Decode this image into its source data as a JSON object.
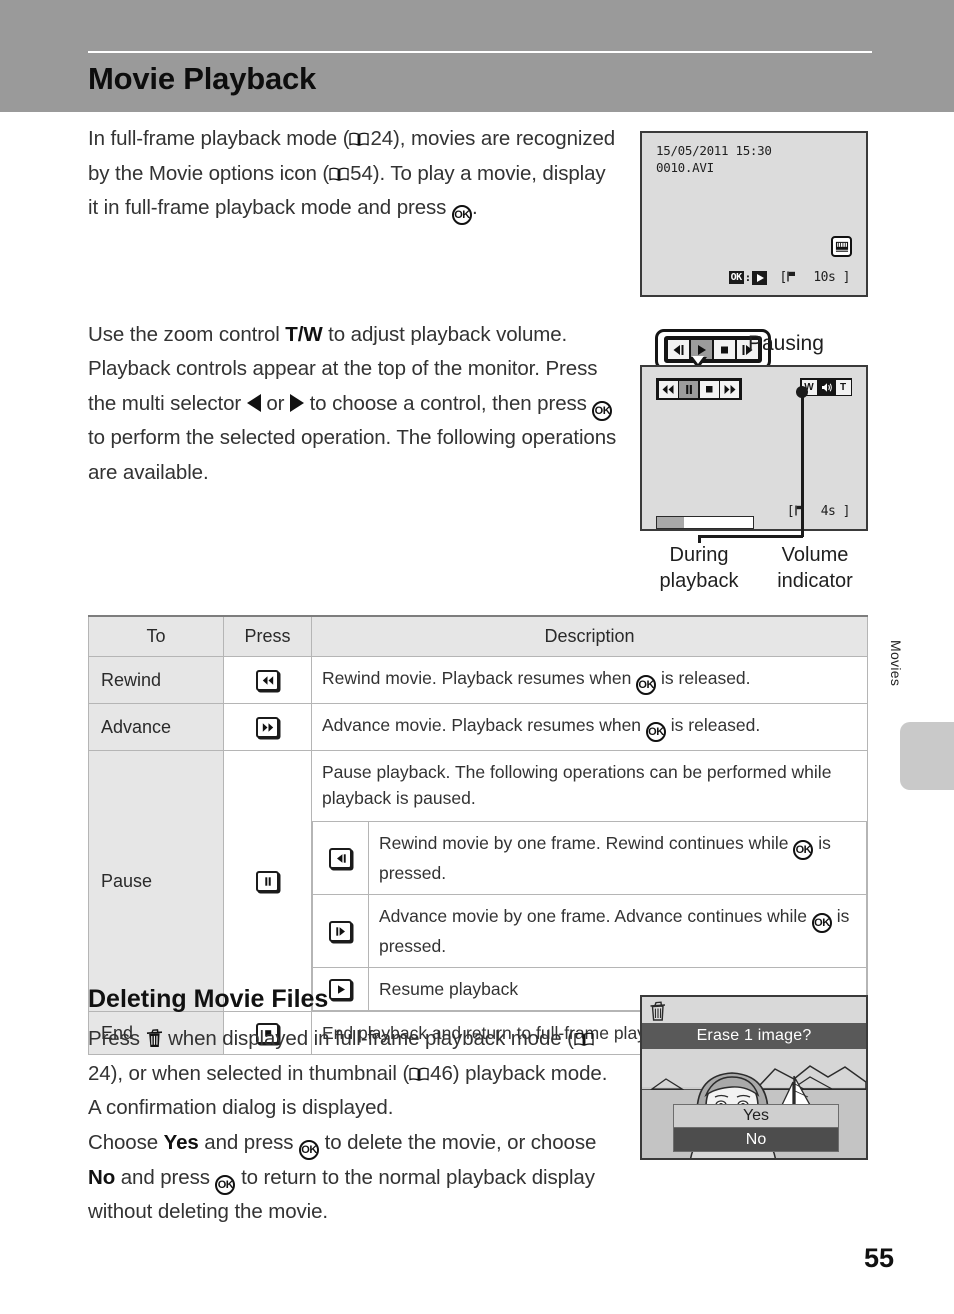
{
  "page": {
    "title": "Movie Playback",
    "number": "55",
    "margin_tab_label": "Movies"
  },
  "intro": {
    "line_a": "In full-frame playback mode (",
    "ref_1": "24",
    "line_b": "), movies are recognized by the Movie options icon (",
    "ref_2": "54",
    "line_c": "). To play a movie, display it in full-frame playback mode and press ",
    "line_d": "."
  },
  "volume_para": {
    "text_a": "Use the zoom control ",
    "zoom_control": "T/W",
    "text_b": " to adjust playback volume."
  },
  "controls_para": {
    "text_a": "Playback controls appear at the top of the monitor. Press the multi selector ",
    "text_b": " or ",
    "text_c": " to choose a control, then press ",
    "text_d": " to perform the selected operation. The following operations are available."
  },
  "monitor_1": {
    "date": "15/05/2011 15:30",
    "filename": "0010.AVI",
    "movie_options_icon": "movie-options-icon",
    "ok_label": "OK",
    "ok_colon": ":",
    "play_icon": "play-icon",
    "frame_flag_icon": "frame-marker-icon",
    "time_remaining": "10s",
    "bracket_open": "[",
    "bracket_close": "]"
  },
  "callout": {
    "label": "Pausing",
    "buttons": [
      {
        "name": "frame-rewind-icon",
        "selected": false
      },
      {
        "name": "play-icon",
        "selected": true
      },
      {
        "name": "stop-icon",
        "selected": false
      },
      {
        "name": "frame-advance-icon",
        "selected": false
      }
    ]
  },
  "monitor_2": {
    "buttons": [
      {
        "name": "rewind-icon",
        "selected": false
      },
      {
        "name": "pause-icon",
        "selected": true
      },
      {
        "name": "stop-icon",
        "selected": false
      },
      {
        "name": "advance-icon",
        "selected": false
      }
    ],
    "volume": {
      "wide_label": "W",
      "speaker_icon": "speaker-icon",
      "tele_label": "T"
    },
    "progress_percent": 28,
    "frame_flag_icon": "frame-marker-icon",
    "time_remaining": "4s",
    "bracket_open": "[",
    "bracket_close": "]"
  },
  "captions": {
    "during_playback": "During\nplayback",
    "during_playback_l1": "During",
    "during_playback_l2": "playback",
    "volume_indicator_l1": "Volume",
    "volume_indicator_l2": "indicator"
  },
  "table": {
    "headers": [
      "To",
      "Press",
      "Description"
    ],
    "rows": [
      {
        "to": "Rewind",
        "press_icon": "rewind-keycap-icon",
        "desc_a": "Rewind movie. Playback resumes when ",
        "desc_b": " is released."
      },
      {
        "to": "Advance",
        "press_icon": "advance-keycap-icon",
        "desc_a": "Advance movie. Playback resumes when ",
        "desc_b": " is released."
      }
    ],
    "pause_row": {
      "to": "Pause",
      "press_icon": "pause-keycap-icon",
      "intro": "Pause playback. The following operations can be performed while playback is paused.",
      "sub_rows": [
        {
          "icon": "frame-rewind-keycap-icon",
          "desc_a": "Rewind movie by one frame. Rewind continues while ",
          "desc_b": " is pressed."
        },
        {
          "icon": "frame-advance-keycap-icon",
          "desc_a": "Advance movie by one frame. Advance continues while ",
          "desc_b": " is pressed."
        },
        {
          "icon": "resume-keycap-icon",
          "desc_a": "Resume playback",
          "desc_b": ""
        }
      ]
    },
    "end_row": {
      "to": "End",
      "press_icon": "stop-keycap-icon",
      "desc": "End playback and return to full-frame playback."
    }
  },
  "section": {
    "heading": "Deleting Movie Files",
    "para_a": "Press ",
    "para_b": " when displayed in full-frame playback mode (",
    "ref_1": "24",
    "para_c": "), or when selected in thumbnail (",
    "ref_2": "46",
    "para_d": ") playback mode. A confirmation dialog is displayed.",
    "para_e": "Choose ",
    "yes_word": "Yes",
    "para_f": " and press ",
    "para_g": " to delete the movie, or choose ",
    "no_word": "No",
    "para_h": " and press ",
    "para_i": " to return to the normal playback display without deleting the movie."
  },
  "erase_dialog": {
    "trash_icon": "trash-icon",
    "title": "Erase 1 image?",
    "choices": [
      {
        "label": "Yes",
        "selected": false
      },
      {
        "label": "No",
        "selected": true
      }
    ]
  },
  "colors": {
    "header_band": "#9a9a9a",
    "monitor_bg": "#dcdcdc",
    "table_head_bg": "#e6e6e6",
    "dialog_bar": "#595959",
    "selected_choice": "#4d4d4d"
  }
}
